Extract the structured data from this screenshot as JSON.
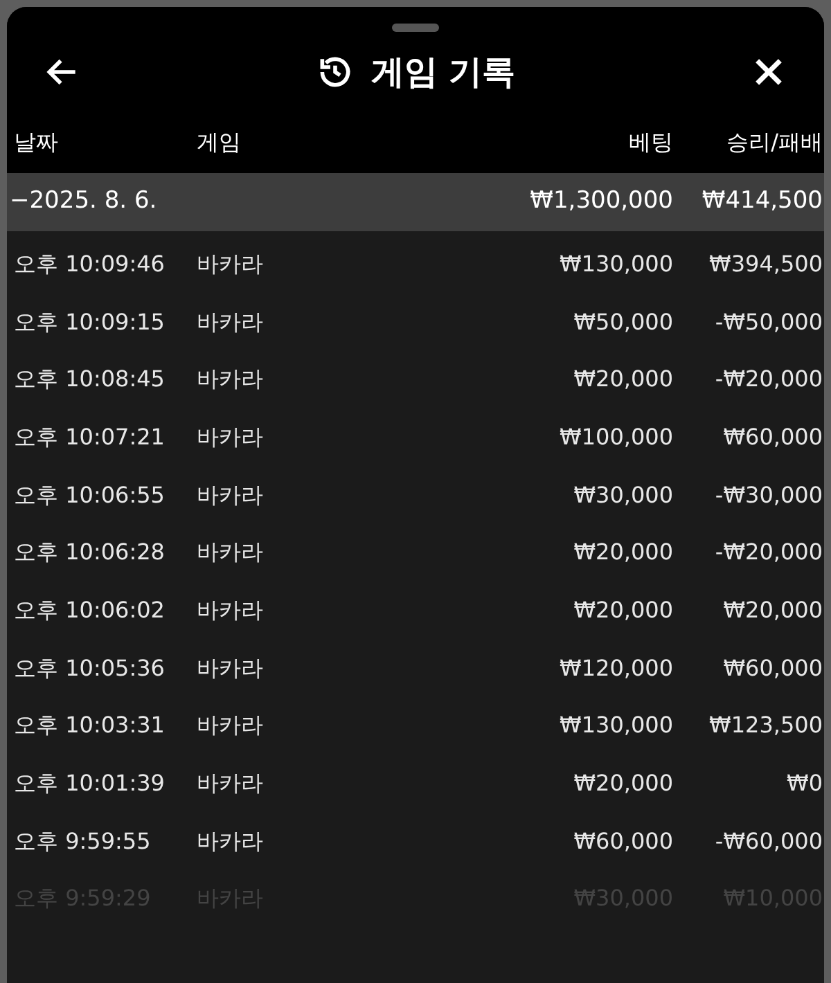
{
  "title": "게임 기록",
  "columns": [
    "날짜",
    "게임",
    "베팅",
    "승리/패배"
  ],
  "group": {
    "date": "−2025. 8. 6.",
    "bet": "₩1,300,000",
    "result": "₩414,500"
  },
  "rows": [
    {
      "time": "오후 10:09:46",
      "game": "바카라",
      "bet": "₩130,000",
      "result": "₩394,500",
      "faded": false
    },
    {
      "time": "오후 10:09:15",
      "game": "바카라",
      "bet": "₩50,000",
      "result": "-₩50,000",
      "faded": false
    },
    {
      "time": "오후 10:08:45",
      "game": "바카라",
      "bet": "₩20,000",
      "result": "-₩20,000",
      "faded": false
    },
    {
      "time": "오후 10:07:21",
      "game": "바카라",
      "bet": "₩100,000",
      "result": "₩60,000",
      "faded": false
    },
    {
      "time": "오후 10:06:55",
      "game": "바카라",
      "bet": "₩30,000",
      "result": "-₩30,000",
      "faded": false
    },
    {
      "time": "오후 10:06:28",
      "game": "바카라",
      "bet": "₩20,000",
      "result": "-₩20,000",
      "faded": false
    },
    {
      "time": "오후 10:06:02",
      "game": "바카라",
      "bet": "₩20,000",
      "result": "₩20,000",
      "faded": false
    },
    {
      "time": "오후 10:05:36",
      "game": "바카라",
      "bet": "₩120,000",
      "result": "₩60,000",
      "faded": false
    },
    {
      "time": "오후 10:03:31",
      "game": "바카라",
      "bet": "₩130,000",
      "result": "₩123,500",
      "faded": false
    },
    {
      "time": "오후 10:01:39",
      "game": "바카라",
      "bet": "₩20,000",
      "result": "₩0",
      "faded": false
    },
    {
      "time": "오후 9:59:55",
      "game": "바카라",
      "bet": "₩60,000",
      "result": "-₩60,000",
      "faded": false
    },
    {
      "time": "오후 9:59:29",
      "game": "바카라",
      "bet": "₩30,000",
      "result": "₩10,000",
      "faded": true
    }
  ]
}
